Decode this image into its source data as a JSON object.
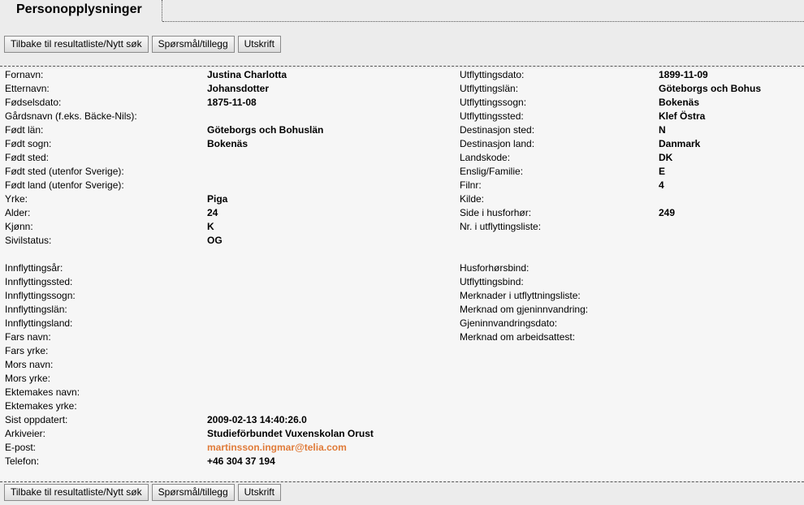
{
  "page": {
    "title": "Personopplysninger"
  },
  "toolbar": {
    "back_label": "Tilbake til resultatliste/Nytt søk",
    "question_label": "Spørsmål/tillegg",
    "print_label": "Utskrift"
  },
  "left_rows": [
    {
      "label": "Fornavn:",
      "value": "Justina Charlotta"
    },
    {
      "label": "Etternavn:",
      "value": "Johansdotter"
    },
    {
      "label": "Fødselsdato:",
      "value": "1875-11-08"
    },
    {
      "label": "Gårdsnavn (f.eks. Bäcke-Nils):",
      "value": ""
    },
    {
      "label": "Født län:",
      "value": "Göteborgs och Bohuslän"
    },
    {
      "label": "Født sogn:",
      "value": "Bokenäs"
    },
    {
      "label": "Født sted:",
      "value": ""
    },
    {
      "label": "Født sted (utenfor Sverige):",
      "value": ""
    },
    {
      "label": "Født land (utenfor Sverige):",
      "value": ""
    },
    {
      "label": "Yrke:",
      "value": "Piga"
    },
    {
      "label": "Alder:",
      "value": "24"
    },
    {
      "label": "Kjønn:",
      "value": "K"
    },
    {
      "label": "Sivilstatus:",
      "value": "OG"
    },
    {
      "label": "",
      "value": ""
    },
    {
      "label": "Innflyttingsår:",
      "value": ""
    },
    {
      "label": "Innflyttingssted:",
      "value": ""
    },
    {
      "label": "Innflyttingssogn:",
      "value": ""
    },
    {
      "label": "Innflyttingslän:",
      "value": ""
    },
    {
      "label": "Innflyttingsland:",
      "value": ""
    },
    {
      "label": "Fars navn:",
      "value": ""
    },
    {
      "label": "Fars yrke:",
      "value": ""
    },
    {
      "label": "Mors navn:",
      "value": ""
    },
    {
      "label": "Mors yrke:",
      "value": ""
    },
    {
      "label": "Ektemakes navn:",
      "value": ""
    },
    {
      "label": "Ektemakes yrke:",
      "value": ""
    },
    {
      "label": "Sist oppdatert:",
      "value": "2009-02-13 14:40:26.0"
    },
    {
      "label": "Arkiveier:",
      "value": "Studieförbundet Vuxenskolan Orust"
    },
    {
      "label": "E-post:",
      "value": "martinsson.ingmar@telia.com",
      "link": true
    },
    {
      "label": "Telefon:",
      "value": "+46 304 37 194"
    }
  ],
  "right_rows": [
    {
      "label": "Utflyttingsdato:",
      "value": "1899-11-09"
    },
    {
      "label": "Utflyttingslän:",
      "value": "Göteborgs och Bohus"
    },
    {
      "label": "Utflyttingssogn:",
      "value": "Bokenäs"
    },
    {
      "label": "Utflyttingssted:",
      "value": "Klef Östra"
    },
    {
      "label": "Destinasjon sted:",
      "value": "N"
    },
    {
      "label": "Destinasjon land:",
      "value": "Danmark"
    },
    {
      "label": "Landskode:",
      "value": "DK"
    },
    {
      "label": "Enslig/Familie:",
      "value": "E"
    },
    {
      "label": "Filnr:",
      "value": "4"
    },
    {
      "label": "Kilde:",
      "value": ""
    },
    {
      "label": "Side i husforhør:",
      "value": "249"
    },
    {
      "label": "Nr. i utflyttingsliste:",
      "value": ""
    },
    {
      "label": "",
      "value": ""
    },
    {
      "label": "",
      "value": ""
    },
    {
      "label": "Husforhørsbind:",
      "value": ""
    },
    {
      "label": "Utflyttingsbind:",
      "value": ""
    },
    {
      "label": "Merknader i utflyttningsliste:",
      "value": ""
    },
    {
      "label": "Merknad om gjeninnvandring:",
      "value": ""
    },
    {
      "label": "Gjeninnvandringsdato:",
      "value": ""
    },
    {
      "label": "Merknad om arbeidsattest:",
      "value": ""
    }
  ],
  "colors": {
    "email": "#e07b39"
  }
}
